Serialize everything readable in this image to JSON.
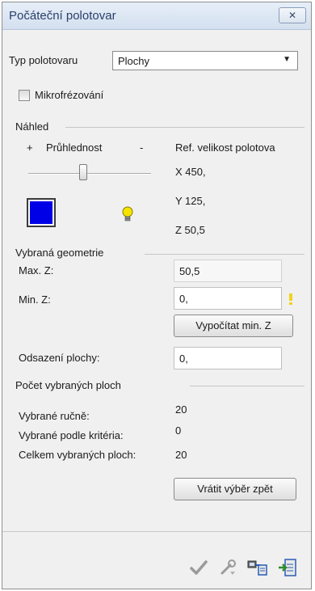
{
  "window": {
    "title": "Počáteční polotovar",
    "close_icon": "close-icon"
  },
  "blank_type": {
    "label": "Typ polotovaru",
    "value": "Plochy"
  },
  "micro_milling": {
    "label": "Mikrofrézování"
  },
  "preview": {
    "group_label": "Náhled",
    "plus": "+",
    "transparency_label": "Průhlednost",
    "minus": "-",
    "transparency_level": 0.45,
    "ref_size_label": "Ref. velikost polotova",
    "x": "X 450,",
    "y": "Y 125,",
    "z": "Z 50,5",
    "color": "#0000e6"
  },
  "geometry": {
    "group_label": "Vybraná geometrie",
    "max_z_label": "Max. Z:",
    "max_z_value": "50,5",
    "min_z_label": "Min. Z:",
    "min_z_value": "0,",
    "compute_button": "Vypočítat min. Z",
    "offset_label": "Odsazení plochy:",
    "offset_value": "0,"
  },
  "surfaces": {
    "group_label": "Počet vybraných ploch",
    "manual_label": "Vybrané ručně:",
    "manual_value": "20",
    "criteria_label": "Vybrané podle kritéria:",
    "criteria_value": "0",
    "total_label": "Celkem vybraných ploch:",
    "total_value": "20",
    "undo_button": "Vrátit výběr zpět"
  },
  "footer": {
    "icons": [
      "checkmark-icon",
      "wrench-icon",
      "transfer-icon",
      "exit-icon"
    ]
  }
}
